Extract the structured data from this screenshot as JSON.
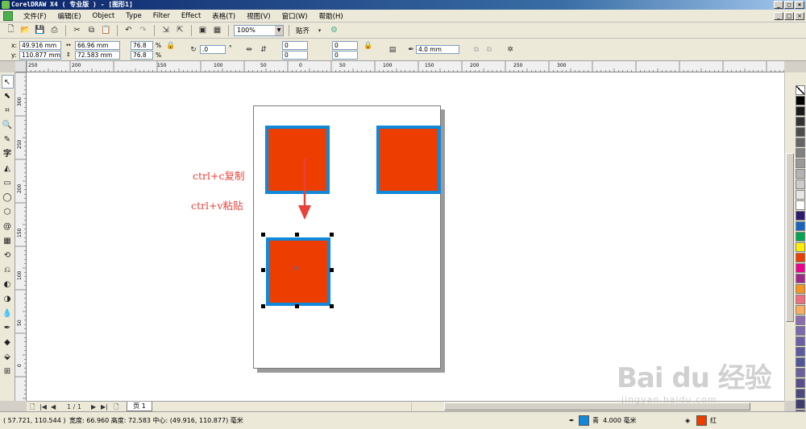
{
  "window": {
    "title": "CorelDRAW X4 ( 专业版 ) - [图形1]"
  },
  "menu": [
    "文件(F)",
    "编辑(E)",
    "Object",
    "Type",
    "Filter",
    "Effect",
    "表格(T)",
    "视图(V)",
    "窗口(W)",
    "帮助(H)"
  ],
  "toolbar": {
    "zoom": "100%",
    "snap_label": "贴齐"
  },
  "propbar": {
    "x_label": "x:",
    "y_label": "y:",
    "x": "49.916 mm",
    "y": "110.877 mm",
    "width": "66.96 mm",
    "height": "72.583 mm",
    "scale_x": "76.8",
    "scale_y": "76.8",
    "percent": "%",
    "rotation": ".0",
    "degree": "°",
    "skew1": "0",
    "skew2": "0",
    "skew3": "0",
    "skew4": "0",
    "outline": "4.0 mm"
  },
  "ruler": {
    "h_labels": [
      "250",
      "200",
      "150",
      "100",
      "50",
      "0",
      "50",
      "100",
      "150",
      "200",
      "250",
      "300"
    ],
    "v_labels": [
      "300",
      "250",
      "200",
      "150",
      "100",
      "50",
      "0"
    ]
  },
  "annotations": {
    "copy": "ctrl+c复制",
    "paste": "ctrl+v粘贴"
  },
  "pagenav": {
    "count": "1 / 1",
    "tab": "页 1"
  },
  "status": {
    "coords": "( 57.721, 110.544 )",
    "info": "宽度: 66.960 高度: 72.583 中心: (49.916, 110.877) 毫米",
    "outline_label": "青",
    "outline_width": "4.000 毫米",
    "fill_label": "红"
  },
  "colors": {
    "fill": "#ee3d00",
    "outline": "#1288d8",
    "arrow": "#e8413a"
  },
  "palette": [
    "#ffffff",
    "#000000",
    "#1a1a1a",
    "#333333",
    "#4d4d4d",
    "#666666",
    "#808080",
    "#999999",
    "#b3b3b3",
    "#cccccc",
    "#e6e6e6",
    "#ffffff",
    "#2e1a6e",
    "#1565c0",
    "#00a651",
    "#ffee00",
    "#ee3d00",
    "#ec008c",
    "#a0288c",
    "#f7941d",
    "#f26d7d",
    "#fbaf5d",
    "#8c6bb1",
    "#7b68ae",
    "#6a5fa8",
    "#5c5aa0",
    "#4e5598",
    "#6b5f9c",
    "#5a4f8c",
    "#4a4a80",
    "#3d3d70",
    "#505080"
  ],
  "watermark": {
    "brand": "Bai du 经验",
    "url": "jingyan.baidu.com"
  }
}
